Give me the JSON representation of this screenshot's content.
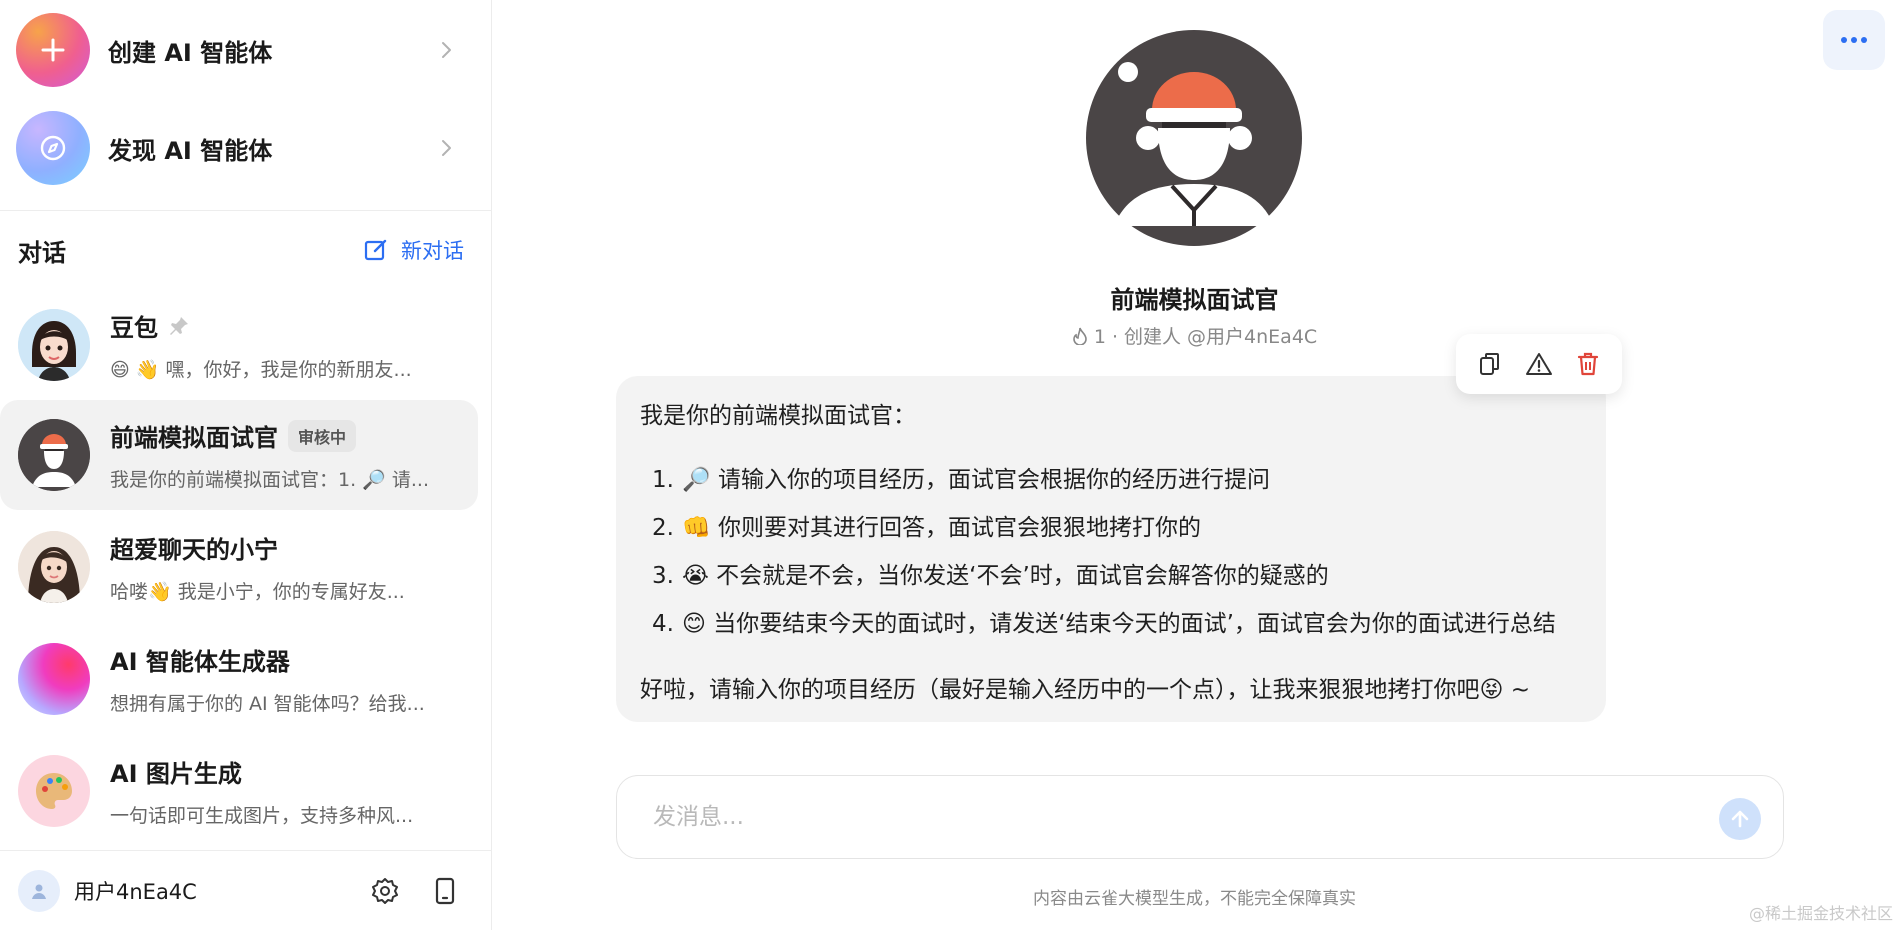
{
  "sidebar": {
    "create_label": "创建 AI 智能体",
    "discover_label": "发现 AI 智能体",
    "conversations_title": "对话",
    "new_chat_label": "新对话",
    "chats": [
      {
        "name": "豆包",
        "preview": "😄 👋 嘿，你好，我是你的新朋友..."
      },
      {
        "name": "前端模拟面试官",
        "badge": "审核中",
        "preview": "我是你的前端模拟面试官：1. 🔎 请..."
      },
      {
        "name": "超爱聊天的小宁",
        "preview": "哈喽👋 我是小宁，你的专属好友..."
      },
      {
        "name": "AI 智能体生成器",
        "preview": "想拥有属于你的 AI 智能体吗？给我..."
      },
      {
        "name": "AI 图片生成",
        "preview": "一句话即可生成图片，支持多种风..."
      }
    ],
    "user": {
      "name": "用户4nEa4C"
    }
  },
  "main": {
    "bot_name": "前端模拟面试官",
    "meta_count": "1",
    "meta_creator": "创建人 @用户4nEa4C",
    "message": {
      "intro": "我是你的前端模拟面试官：",
      "items": [
        {
          "num": "1.",
          "text": "🔎 请输入你的项目经历，面试官会根据你的经历进行提问"
        },
        {
          "num": "2.",
          "text": "👊 你则要对其进行回答，面试官会狠狠地拷打你的"
        },
        {
          "num": "3.",
          "text": "😭 不会就是不会，当你发送‘不会’时，面试官会解答你的疑惑的"
        },
        {
          "num": "4.",
          "text": "😊 当你要结束今天的面试时，请发送‘结束今天的面试’，面试官会为你的面试进行总结"
        }
      ],
      "outro": "好啦，请输入你的项目经历（最好是输入经历中的一个点），让我来狠狠地拷打你吧😝 ~"
    },
    "input_placeholder": "发消息...",
    "disclaimer": "内容由云雀大模型生成，不能完全保障真实",
    "watermark": "@稀土掘金技术社区"
  },
  "colors": {
    "accent": "#2c6ef2",
    "delete": "#e0453a",
    "bot_hat": "#ec6c4a",
    "bot_bg": "#4a4546"
  }
}
